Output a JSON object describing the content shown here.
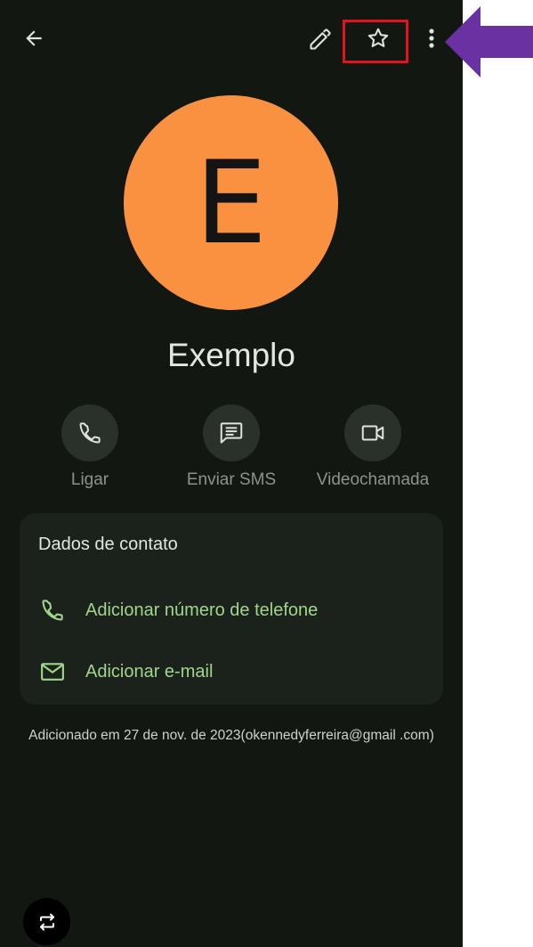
{
  "contact": {
    "initial": "E",
    "name": "Exemplo"
  },
  "actions": [
    {
      "label": "Ligar",
      "icon": "phone-icon"
    },
    {
      "label": "Enviar SMS",
      "icon": "message-icon"
    },
    {
      "label": "Videochamada",
      "icon": "videocam-icon"
    }
  ],
  "contact_info": {
    "title": "Dados de contato",
    "add_phone": "Adicionar número de telefone",
    "add_email": "Adicionar e-mail"
  },
  "added_note": "Adicionado em 27 de nov. de 2023(okennedyferreira@gmail .com)",
  "colors": {
    "background": "#131712",
    "avatar": "#fa9141",
    "accent_green": "#a2d58c",
    "highlight_red": "#e4121e",
    "annotation_purple": "#6a31a3"
  },
  "icons": {
    "toolbar": [
      "back-arrow-icon",
      "edit-pencil-icon",
      "star-outline-icon",
      "more-vert-icon"
    ],
    "rows": [
      "phone-icon",
      "mail-icon"
    ],
    "floating": "screen-rotate-icon"
  }
}
